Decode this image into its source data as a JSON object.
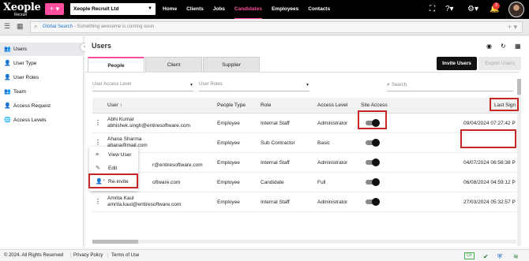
{
  "topbar": {
    "logo_main": "Xeople",
    "logo_sub": "Recruit",
    "plus_label": "+ ▾",
    "company": "Xeople Recruit Ltd",
    "nav": [
      "Home",
      "Clients",
      "Jobs",
      "Candidates",
      "Employees",
      "Contacts"
    ],
    "notification_count": "3",
    "icons": [
      "expand-icon",
      "help-icon",
      "settings-icon",
      "bell-icon",
      "avatar"
    ]
  },
  "search": {
    "label": "Global Search",
    "message": " - Something awesome is coming soon"
  },
  "sidebar": {
    "items": [
      {
        "label": "Users",
        "icon": "users-icon"
      },
      {
        "label": "User Type",
        "icon": "user-type-icon"
      },
      {
        "label": "User Roles",
        "icon": "user-roles-icon"
      },
      {
        "label": "Team",
        "icon": "team-icon"
      },
      {
        "label": "Access Request",
        "icon": "access-request-icon"
      },
      {
        "label": "Access Levels",
        "icon": "globe-icon"
      }
    ]
  },
  "main": {
    "title": "Users",
    "tabs": [
      "People",
      "Client",
      "Supplier"
    ],
    "invite_button": "Invite Users",
    "export_button": "Export Users",
    "filters": {
      "access_level": "User Access Level",
      "roles": "User Roles",
      "search": "Search"
    },
    "columns": [
      "User",
      "People Type",
      "Role",
      "Access Level",
      "Site Access",
      "Last Sign"
    ],
    "sort_arrow": "↑",
    "rows": [
      {
        "name": "Abhi Kumar",
        "email": "abhishek.singh@entiresoftware.com",
        "people_type": "Employee",
        "role": "Internal Staff",
        "access_level": "Administrator",
        "last_sign": "09/04/2024 07:27:42 P"
      },
      {
        "name": "Ahana Sharma",
        "email": "ahana@mail.com",
        "people_type": "Employee",
        "role": "Sub Contractor",
        "access_level": "Basic",
        "last_sign": ""
      },
      {
        "name": "",
        "email": "r@entiresoftware.com",
        "people_type": "Employee",
        "role": "Internal Staff",
        "access_level": "Administrator",
        "last_sign": "04/07/2024 06:56:38 P"
      },
      {
        "name": "",
        "email": "oftware.com",
        "people_type": "Employee",
        "role": "Candidate",
        "access_level": "Full",
        "last_sign": "06/08/2024 04:59:12 P"
      },
      {
        "name": "Amrita Kaul",
        "email": "amrita.kaul@entiresoftware.com",
        "people_type": "Employee",
        "role": "Internal Staff",
        "access_level": "Administrator",
        "last_sign": "27/03/2024 05:32:57 P"
      }
    ],
    "context_menu": [
      {
        "label": "View User",
        "icon": "list-icon"
      },
      {
        "label": "Edit",
        "icon": "pencil-icon"
      },
      {
        "label": "Re-invite",
        "icon": "user-plus-icon"
      }
    ]
  },
  "footer": {
    "copyright": "© 2024. All Rights Reserved",
    "privacy": "Privacy Policy",
    "terms": "Terms of Use",
    "badge": "Q4"
  }
}
